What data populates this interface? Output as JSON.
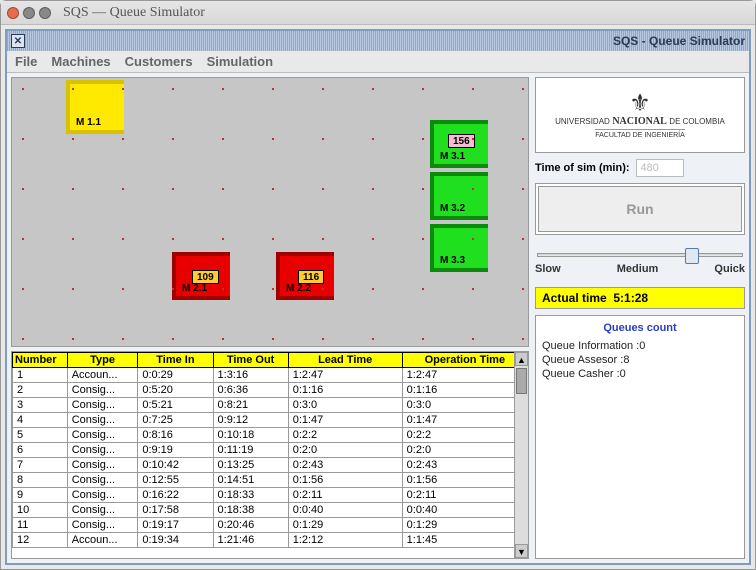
{
  "os_title": "SQS — Queue Simulator",
  "app_title": "SQS - Queue Simulator",
  "menu": {
    "file": "File",
    "machines": "Machines",
    "customers": "Customers",
    "simulation": "Simulation"
  },
  "machines": {
    "m11": "M 1.1",
    "m21": "M 2.1",
    "t21": "109",
    "m22": "M 2.2",
    "t22": "116",
    "m31": "M 3.1",
    "t31": "156",
    "m32": "M 3.2",
    "m33": "M 3.3"
  },
  "table": {
    "headers": [
      "Number",
      "Type",
      "Time In",
      "Time Out",
      "Lead Time",
      "Operation Time"
    ],
    "rows": [
      [
        "1",
        "Accoun...",
        "0:0:29",
        "1:3:16",
        "1:2:47",
        "1:2:47"
      ],
      [
        "2",
        "Consig...",
        "0:5:20",
        "0:6:36",
        "0:1:16",
        "0:1:16"
      ],
      [
        "3",
        "Consig...",
        "0:5:21",
        "0:8:21",
        "0:3:0",
        "0:3:0"
      ],
      [
        "4",
        "Consig...",
        "0:7:25",
        "0:9:12",
        "0:1:47",
        "0:1:47"
      ],
      [
        "5",
        "Consig...",
        "0:8:16",
        "0:10:18",
        "0:2:2",
        "0:2:2"
      ],
      [
        "6",
        "Consig...",
        "0:9:19",
        "0:11:19",
        "0:2:0",
        "0:2:0"
      ],
      [
        "7",
        "Consig...",
        "0:10:42",
        "0:13:25",
        "0:2:43",
        "0:2:43"
      ],
      [
        "8",
        "Consig...",
        "0:12:55",
        "0:14:51",
        "0:1:56",
        "0:1:56"
      ],
      [
        "9",
        "Consig...",
        "0:16:22",
        "0:18:33",
        "0:2:11",
        "0:2:11"
      ],
      [
        "10",
        "Consig...",
        "0:17:58",
        "0:18:38",
        "0:0:40",
        "0:0:40"
      ],
      [
        "11",
        "Consig...",
        "0:19:17",
        "0:20:46",
        "0:1:29",
        "0:1:29"
      ],
      [
        "12",
        "Accoun...",
        "0:19:34",
        "1:21:46",
        "1:2:12",
        "1:1:45"
      ]
    ]
  },
  "logo": {
    "line1": "UNIVERSIDAD NACIONAL DE COLOMBIA",
    "line2": "FACULTAD DE INGENIERÍA"
  },
  "sim": {
    "time_label": "Time of sim (min):",
    "time_value": "480",
    "run": "Run",
    "slow": "Slow",
    "medium": "Medium",
    "quick": "Quick",
    "actual_label": "Actual time",
    "actual_value": "5:1:28"
  },
  "queues": {
    "title": "Queues count",
    "info_label": "Queue Information :",
    "info_val": "0",
    "assesor_label": "Queue Assesor :",
    "assesor_val": "8",
    "casher_label": "Queue Casher :",
    "casher_val": "0"
  }
}
